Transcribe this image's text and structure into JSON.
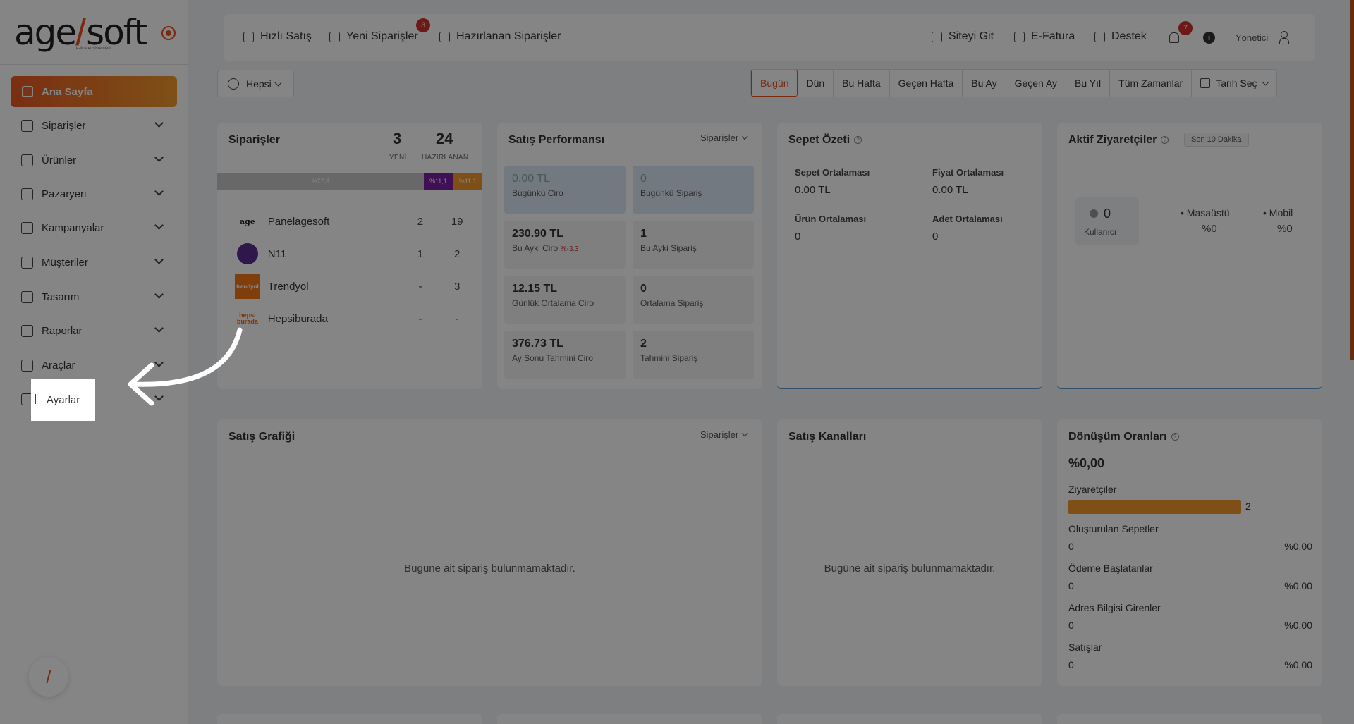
{
  "logo": {
    "brand_left": "age",
    "brand_slash": "/",
    "brand_right": "soft",
    "tagline": "e-ticaret sistemleri"
  },
  "sidebar": {
    "active": "Ana Sayfa",
    "items": [
      {
        "label": "Siparişler"
      },
      {
        "label": "Ürünler"
      },
      {
        "label": "Pazaryeri"
      },
      {
        "label": "Kampanyalar"
      },
      {
        "label": "Müşteriler"
      },
      {
        "label": "Tasarım"
      },
      {
        "label": "Raporlar"
      },
      {
        "label": "Araçlar"
      },
      {
        "label": "Ayarlar"
      }
    ],
    "pen_icon": "pen-icon"
  },
  "topbar": {
    "quick_sale": "Hızlı Satış",
    "new_orders": "Yeni Siparişler",
    "new_orders_badge": "3",
    "prepared_orders": "Hazırlanan Siparişler",
    "site": "Siteyi Git",
    "einvoice": "E-Fatura",
    "support": "Destek",
    "bell_badge": "7",
    "info": "i",
    "user": "Yönetici"
  },
  "filters": {
    "scope": "Hepsi",
    "ranges": [
      "Bugün",
      "Dün",
      "Bu Hafta",
      "Geçen Hafta",
      "Bu Ay",
      "Geçen Ay",
      "Bu Yıl",
      "Tüm Zamanlar"
    ],
    "active_range": "Bugün",
    "date_pick": "Tarih Seç"
  },
  "orders": {
    "title": "Siparişler",
    "new_count": "3",
    "new_label": "YENİ",
    "prep_count": "24",
    "prep_label": "HAZIRLANAN",
    "bar": [
      {
        "label": "%77,8",
        "share": 77.8,
        "color": "#c8c8c8"
      },
      {
        "label": "%11,1",
        "share": 11.1,
        "color": "#7b1fa2"
      },
      {
        "label": "%11,1",
        "share": 11.1,
        "color": "#f29a2c"
      }
    ],
    "rows": [
      {
        "name": "Panelagesoft",
        "new": "2",
        "prep": "19"
      },
      {
        "name": "N11",
        "new": "1",
        "prep": "2"
      },
      {
        "name": "Trendyol",
        "new": "-",
        "prep": "3"
      },
      {
        "name": "Hepsiburada",
        "new": "-",
        "prep": "-"
      }
    ],
    "logo_text": {
      "trendyol": "trendyol",
      "hepsi": "hepsi burada"
    }
  },
  "performance": {
    "title": "Satış Performansı",
    "dropdown": "Siparişler",
    "boxes": [
      {
        "value": "0.00 TL",
        "label": "Bugünkü Ciro"
      },
      {
        "value": "0",
        "label": "Bugünkü Sipariş"
      },
      {
        "value": "230.90 TL",
        "label": "Bu Ayki Ciro",
        "change": "%-3.3"
      },
      {
        "value": "1",
        "label": "Bu Ayki Sipariş"
      },
      {
        "value": "12.15 TL",
        "label": "Günlük Ortalama Ciro"
      },
      {
        "value": "0",
        "label": "Ortalama Sipariş"
      },
      {
        "value": "376.73 TL",
        "label": "Ay Sonu Tahmini Ciro"
      },
      {
        "value": "2",
        "label": "Tahmini Sipariş"
      }
    ]
  },
  "basket": {
    "title": "Sepet Özeti",
    "items": [
      {
        "label": "Sepet Ortalaması",
        "value": "0.00 TL"
      },
      {
        "label": "Fiyat Ortalaması",
        "value": "0.00 TL"
      },
      {
        "label": "Ürün Ortalaması",
        "value": "0"
      },
      {
        "label": "Adet Ortalaması",
        "value": "0"
      }
    ]
  },
  "visitors": {
    "title": "Aktif Ziyaretçiler",
    "window": "Son 10 Dakika",
    "count": "0",
    "count_label": "Kullanıcı",
    "desktop_label": "Masaüstü",
    "desktop_value": "%0",
    "mobile_label": "Mobil",
    "mobile_value": "%0"
  },
  "sales_chart": {
    "title": "Satış Grafiği",
    "dropdown": "Siparişler",
    "empty": "Bugüne ait sipariş bulunmamaktadır."
  },
  "channels": {
    "title": "Satış Kanalları",
    "empty": "Bugüne ait sipariş bulunmamaktadır."
  },
  "conversion": {
    "title": "Dönüşüm Oranları",
    "rate": "%0,00",
    "visitors_label": "Ziyaretçiler",
    "visitors_value": "2",
    "rows": [
      {
        "label": "Oluşturulan Sepetler",
        "count": "0",
        "pct": "%0,00"
      },
      {
        "label": "Ödeme Başlatanlar",
        "count": "0",
        "pct": "%0,00"
      },
      {
        "label": "Adres Bilgisi Girenler",
        "count": "0",
        "pct": "%0,00"
      },
      {
        "label": "Satışlar",
        "count": "0",
        "pct": "%0,00"
      }
    ]
  },
  "colors": {
    "accent": "#e8521f",
    "accent2": "#f29a2c",
    "purple": "#7b1fa2",
    "blue_line": "#5b9bd5"
  }
}
